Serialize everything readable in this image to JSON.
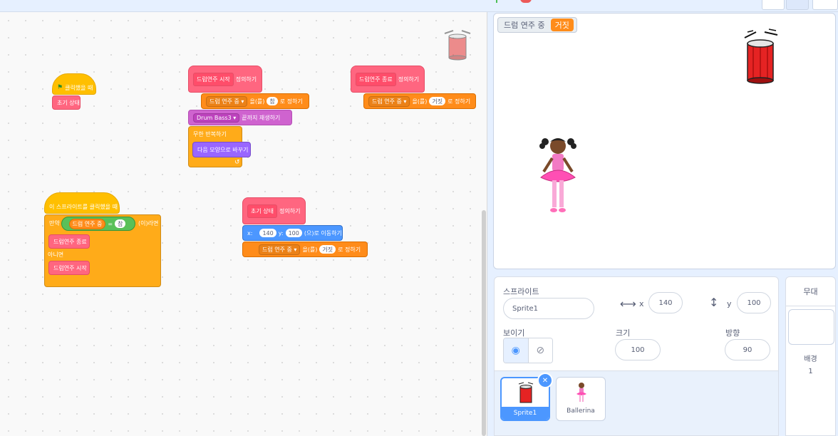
{
  "workspace": {
    "script1": {
      "hat": "클릭했을 때",
      "call": "초기 상태"
    },
    "script2": {
      "define_name": "드럼연주 시작",
      "define_label": "정의하기",
      "set_var": "드럼 연주 중",
      "set_mid": "을(를)",
      "set_val": "참",
      "set_end": "로 정하기",
      "sound": "Drum Bass3",
      "sound_end": "끝까지 재생하기",
      "forever": "무한 반복하기",
      "costume": "다음 모양으로 바꾸기"
    },
    "script3": {
      "define_name": "드럼연주 종료",
      "define_label": "정의하기",
      "set_var": "드럼 연주 중",
      "set_mid": "을(를)",
      "set_val": "거짓",
      "set_end": "로 정하기"
    },
    "script4": {
      "hat": "이 스프라이트를 클릭했을 때",
      "if": "만약",
      "cond_var": "드럼 연주 중",
      "cond_op": "=",
      "cond_val": "참",
      "then": "(이)라면",
      "call_stop": "드럼연주 종료",
      "else": "아니면",
      "call_start": "드럼연주 시작"
    },
    "script5": {
      "define_name": "초기 상태",
      "define_label": "정의하기",
      "goto_x_label": "x:",
      "goto_x": "140",
      "goto_y_label": "y:",
      "goto_y": "100",
      "goto_end": "(으)로 이동하기",
      "set_var": "드럼 연주 중",
      "set_mid": "을(를)",
      "set_val": "거짓",
      "set_end": "로 정하기"
    }
  },
  "stage": {
    "monitor_label": "드럼 연주 중",
    "monitor_value": "거짓"
  },
  "sprite_info": {
    "sprite_label": "스프라이트",
    "sprite_name": "Sprite1",
    "x_label": "x",
    "x_value": "140",
    "y_label": "y",
    "y_value": "100",
    "show_label": "보이기",
    "size_label": "크기",
    "size_value": "100",
    "direction_label": "방향",
    "direction_value": "90"
  },
  "sprites": [
    {
      "name": "Sprite1",
      "selected": true
    },
    {
      "name": "Ballerina",
      "selected": false
    }
  ],
  "stage_panel": {
    "title": "무대",
    "backdrops_label": "배경",
    "backdrops_count": "1"
  },
  "colors": {
    "events": "#ffbf00",
    "custom": "#ff6680",
    "variables": "#ff8c1a",
    "sound": "#cf63cf",
    "control": "#ffab19",
    "looks": "#9966ff",
    "motion": "#4c97ff",
    "operators": "#59c059",
    "accent": "#4c97ff"
  }
}
